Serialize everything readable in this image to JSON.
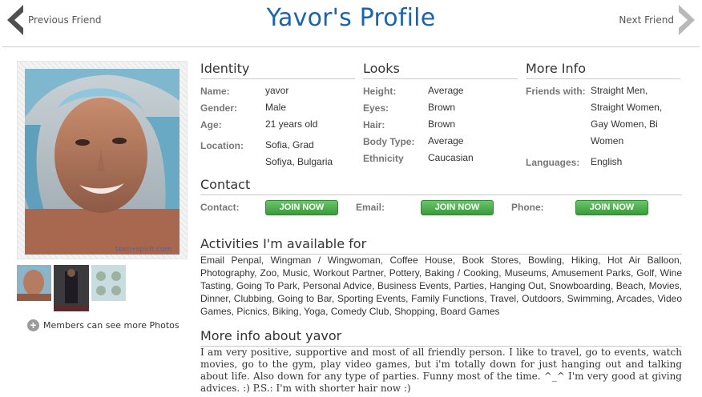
{
  "header": {
    "title": "Yavor's Profile",
    "prev_label": "Previous Friend",
    "next_label": "Next Friend"
  },
  "photos": {
    "watermark": "teen-spirit.com",
    "more_label": "Members can see more Photos"
  },
  "identity": {
    "title": "Identity",
    "name_label": "Name:",
    "name": "yavor",
    "gender_label": "Gender:",
    "gender": "Male",
    "age_label": "Age:",
    "age": "21 years old",
    "location_label": "Location:",
    "location_line1": "Sofia, Grad",
    "location_line2": "Sofiya, Bulgaria"
  },
  "looks": {
    "title": "Looks",
    "height_label": "Height:",
    "height": "Average",
    "eyes_label": "Eyes:",
    "eyes": "Brown",
    "hair_label": "Hair:",
    "hair": "Brown",
    "body_label": "Body Type:",
    "body": "Average",
    "ethnicity_label": "Ethnicity",
    "ethnicity": "Caucasian"
  },
  "more_info": {
    "title": "More Info",
    "friends_label": "Friends with:",
    "friends_line1": "Straight Men,",
    "friends_line2": "Straight Women,",
    "friends_line3": "Gay Women, Bi",
    "friends_line4": "Women",
    "languages_label": "Languages:",
    "languages": "English"
  },
  "contact": {
    "title": "Contact",
    "contact_label": "Contact:",
    "email_label": "Email:",
    "phone_label": "Phone:",
    "join_label": "JOIN NOW"
  },
  "activities": {
    "title": "Activities I'm available for",
    "text": "Email Penpal, Wingman / Wingwoman, Coffee House, Book Stores, Bowling, Hiking, Hot Air Balloon, Photography, Zoo, Music, Workout Partner, Pottery, Baking / Cooking, Museums, Amusement Parks, Golf, Wine Tasting, Going To Park, Personal Advice, Business Events, Parties, Hanging Out, Snowboarding, Beach, Movies, Dinner, Clubbing, Going to Bar, Sporting Events, Family Functions, Travel, Outdoors, Swimming, Arcades, Video Games, Picnics, Biking, Yoga, Comedy Club, Shopping, Board Games"
  },
  "about": {
    "title": "More info about yavor",
    "text": "I am very positive, supportive and most of all friendly person. I like to travel, go to events, watch movies, go to the gym, play video games, but i'm totally down for just hanging out and talking about life. Also down for any type of parties. Funny most of the time. ^_^ I'm very good at giving advices. :) P.S.: I'm with shorter hair now :)"
  },
  "colors": {
    "title_blue": "#1a63ad",
    "join_green": "#4caf50",
    "arrow_gray": "#555555"
  },
  "icons": {
    "prev": "chevron-left-icon",
    "next": "chevron-right-icon",
    "more": "plus-circle-icon"
  }
}
